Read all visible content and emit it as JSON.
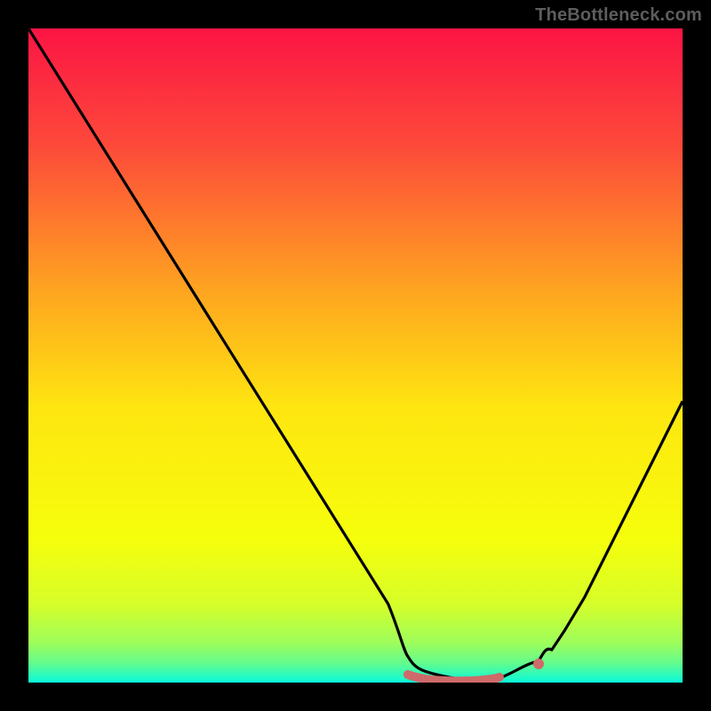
{
  "watermark": "TheBottleneck.com",
  "chart_data": {
    "type": "line",
    "title": "",
    "xlabel": "",
    "ylabel": "",
    "xlim": [
      0,
      100
    ],
    "ylim": [
      0,
      100
    ],
    "grid": false,
    "legend": false,
    "background": "vertical-gradient red-yellow-green",
    "series": [
      {
        "name": "bottleneck-curve",
        "color": "#000000",
        "x": [
          0,
          5,
          10,
          15,
          20,
          25,
          30,
          35,
          40,
          45,
          50,
          55,
          58,
          60,
          62,
          65,
          68,
          70,
          72,
          75,
          78,
          80,
          82,
          85,
          88,
          92,
          96,
          100
        ],
        "y": [
          100,
          92,
          84,
          76,
          68,
          60,
          52,
          44,
          36,
          28,
          20,
          12,
          7,
          4,
          2.5,
          1.2,
          0.6,
          0.4,
          0.5,
          1.0,
          2.5,
          5,
          8,
          13,
          19,
          27,
          35,
          43
        ]
      }
    ],
    "highlight_segment": {
      "name": "optimal-range",
      "color": "#ce6a6a",
      "x_range": [
        58,
        72
      ],
      "y_approx": 0.8,
      "endpoint_marker_x": 72
    },
    "gradient_stops": [
      {
        "pct": 0,
        "color": "#fc1444"
      },
      {
        "pct": 18,
        "color": "#fd4a3a"
      },
      {
        "pct": 40,
        "color": "#fea420"
      },
      {
        "pct": 58,
        "color": "#fee610"
      },
      {
        "pct": 78,
        "color": "#f6fe0c"
      },
      {
        "pct": 88,
        "color": "#d6fe29"
      },
      {
        "pct": 94,
        "color": "#9dfd5c"
      },
      {
        "pct": 97,
        "color": "#64fc8d"
      },
      {
        "pct": 100,
        "color": "#09f9db"
      }
    ]
  }
}
